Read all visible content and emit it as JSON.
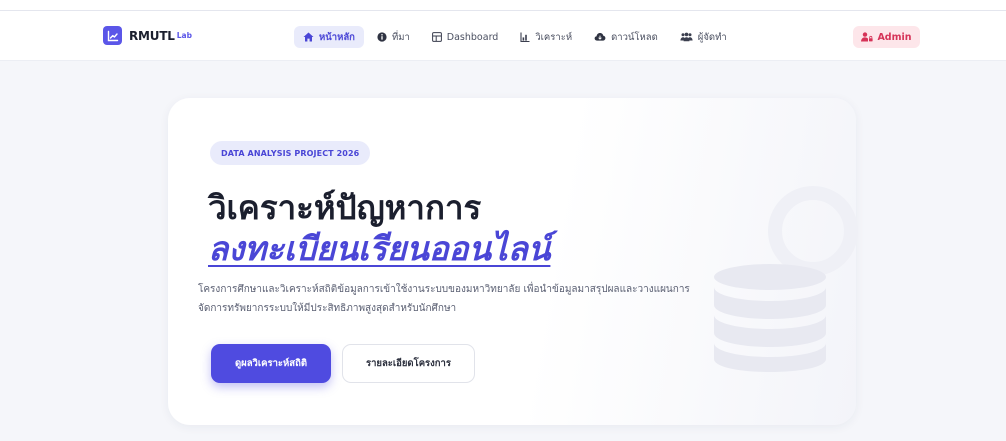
{
  "brand": {
    "name": "RMUTL",
    "sub": "Lab",
    "color": "#5b56e8"
  },
  "nav": {
    "items": [
      {
        "label": "หน้าหลัก",
        "icon": "home-icon",
        "active": true
      },
      {
        "label": "ที่มา",
        "icon": "info-icon",
        "active": false
      },
      {
        "label": "Dashboard",
        "icon": "dashboard-icon",
        "active": false
      },
      {
        "label": "วิเคราะห์",
        "icon": "analysis-icon",
        "active": false
      },
      {
        "label": "ดาวน์โหลด",
        "icon": "cloud-download-icon",
        "active": false
      },
      {
        "label": "ผู้จัดทำ",
        "icon": "team-icon",
        "active": false
      }
    ],
    "admin_label": "Admin"
  },
  "hero": {
    "badge": "DATA ANALYSIS PROJECT 2026",
    "title_line1": "วิเคราะห์ปัญหาการ",
    "title_line2": "ลงทะเบียนเรียนออนไลน์",
    "description": "โครงการศึกษาและวิเคราะห์สถิติข้อมูลการเข้าใช้งานระบบของมหาวิทยาลัย เพื่อนำข้อมูลมาสรุปผลและวางแผนการจัดการทรัพยากรระบบให้มีประสิทธิภาพสูงสุดสำหรับนักศึกษา",
    "primary_button": "ดูผลวิเคราะห์สถิติ",
    "secondary_button": "รายละเอียดโครงการ",
    "illustration_icon": "database-icon"
  },
  "colors": {
    "accent": "#4f4be0",
    "admin_bg": "#fde6ea",
    "admin_text": "#d63358"
  }
}
